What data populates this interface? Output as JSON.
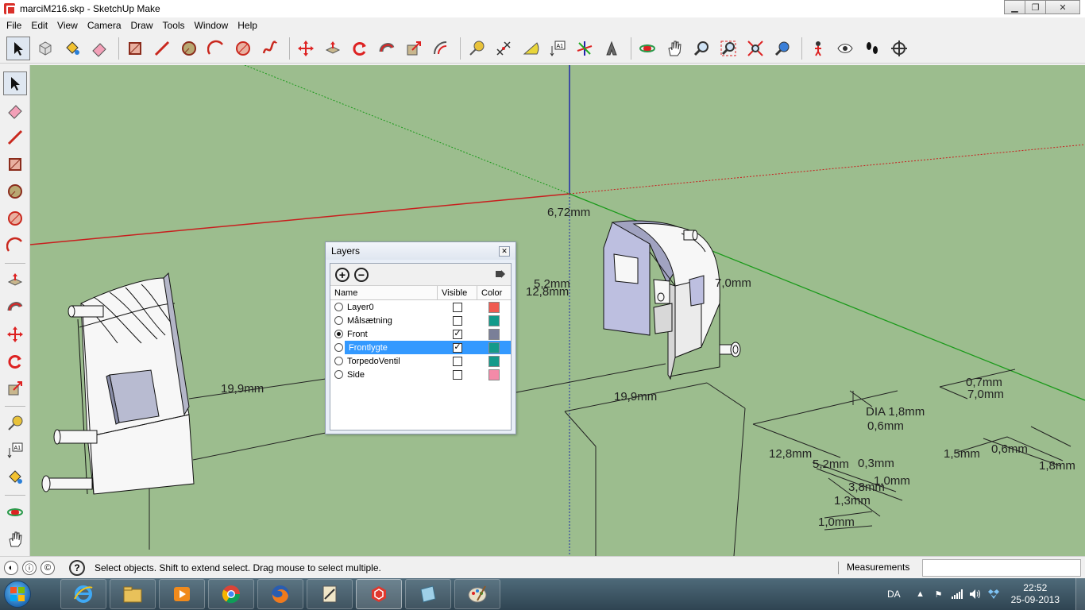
{
  "window": {
    "title": "marciM216.skp - SketchUp Make",
    "minimize": "▁",
    "maximize": "❐",
    "close": "✕"
  },
  "menu": [
    "File",
    "Edit",
    "View",
    "Camera",
    "Draw",
    "Tools",
    "Window",
    "Help"
  ],
  "toolbar": {
    "tools": [
      "select-icon",
      "make-component-icon",
      "paint-bucket-icon",
      "eraser-icon",
      "rectangle-icon",
      "line-icon",
      "circle-icon",
      "arc-icon",
      "polygon-icon",
      "freehand-icon",
      "move-icon",
      "push-pull-icon",
      "rotate-icon",
      "follow-me-icon",
      "scale-icon",
      "offset-icon",
      "tape-measure-icon",
      "dimension-icon",
      "protractor-icon",
      "text-icon",
      "axes-icon",
      "3d-text-icon",
      "orbit-icon",
      "pan-icon",
      "zoom-icon",
      "zoom-window-icon",
      "zoom-extents-icon",
      "previous-view-icon",
      "position-camera-icon",
      "look-around-icon",
      "walk-icon",
      "section-plane-icon"
    ]
  },
  "left_toolbar": {
    "tools": [
      "select-icon",
      "eraser-icon",
      "line-icon",
      "rectangle-icon",
      "circle-icon",
      "polygon-icon",
      "arc-icon",
      "push-pull-icon",
      "follow-me-icon",
      "move-icon",
      "rotate-icon",
      "scale-icon",
      "tape-measure-icon",
      "text-icon",
      "paint-bucket-icon",
      "orbit-icon",
      "pan-icon"
    ]
  },
  "viewport": {
    "background": "#9cbd8e",
    "dimensions": [
      {
        "id": "d1",
        "text": "6,72mm"
      },
      {
        "id": "d2",
        "text": "5,2mm"
      },
      {
        "id": "d3",
        "text": "12,8mm"
      },
      {
        "id": "d4",
        "text": "7,0mm"
      },
      {
        "id": "d5",
        "text": "19,9mm"
      },
      {
        "id": "d6",
        "text": "19,9mm"
      },
      {
        "id": "d7",
        "text": "0,7mm"
      },
      {
        "id": "d8",
        "text": "7,0mm"
      },
      {
        "id": "d9",
        "text": "DIA 1,8mm"
      },
      {
        "id": "d10",
        "text": "0,6mm"
      },
      {
        "id": "d11",
        "text": "12,8mm"
      },
      {
        "id": "d12",
        "text": "5,2mm"
      },
      {
        "id": "d13",
        "text": "0,3mm"
      },
      {
        "id": "d14",
        "text": "1,0mm"
      },
      {
        "id": "d15",
        "text": "3,8mm"
      },
      {
        "id": "d16",
        "text": "1,3mm"
      },
      {
        "id": "d17",
        "text": "1,0mm"
      },
      {
        "id": "d18",
        "text": "1,5mm"
      },
      {
        "id": "d19",
        "text": "0,6mm"
      },
      {
        "id": "d20",
        "text": "1,8mm"
      }
    ]
  },
  "layers_dialog": {
    "title": "Layers",
    "close_label": "✕",
    "add_label": "+",
    "remove_label": "−",
    "columns": {
      "name": "Name",
      "visible": "Visible",
      "color": "Color"
    },
    "rows": [
      {
        "name": "Layer0",
        "active": false,
        "visible": false,
        "color": "#f05a50",
        "selected": false
      },
      {
        "name": "Målsætning",
        "active": false,
        "visible": false,
        "color": "#139a8a",
        "selected": false
      },
      {
        "name": "Front",
        "active": true,
        "visible": true,
        "color": "#7a7f98",
        "selected": false
      },
      {
        "name": "Frontlygte",
        "active": false,
        "visible": true,
        "color": "#149a8a",
        "selected": true
      },
      {
        "name": "TorpedoVentil",
        "active": false,
        "visible": false,
        "color": "#149a8a",
        "selected": false
      },
      {
        "name": "Side",
        "active": false,
        "visible": false,
        "color": "#f48aa8",
        "selected": false
      }
    ]
  },
  "statusbar": {
    "text": "Select objects. Shift to extend select. Drag mouse to select multiple.",
    "measurements_label": "Measurements",
    "measurements_value": ""
  },
  "taskbar": {
    "apps": [
      "internet-explorer-icon",
      "file-explorer-icon",
      "media-player-icon",
      "chrome-icon",
      "firefox-icon",
      "tool-app-icon",
      "sketchup-icon",
      "notebook-icon",
      "paint-icon"
    ],
    "running_index": 6,
    "language": "DA",
    "time": "22:52",
    "date": "25-09-2013"
  }
}
